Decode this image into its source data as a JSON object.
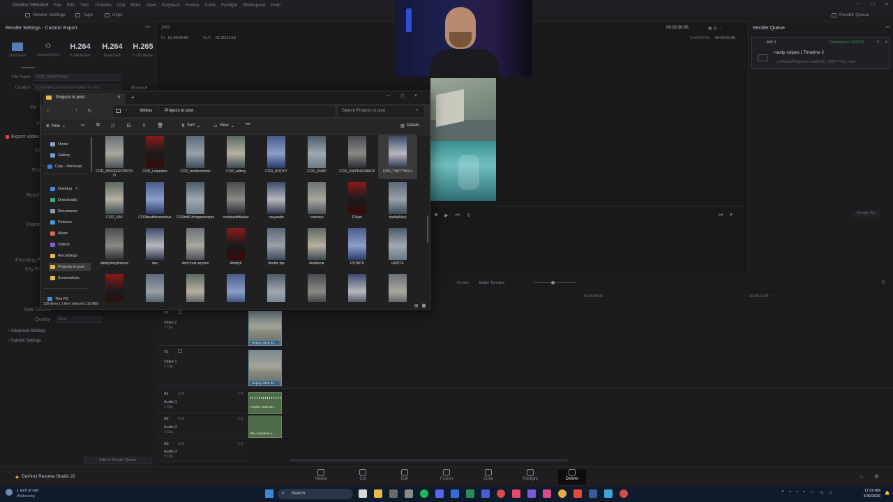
{
  "menubar": {
    "app_name": "DaVinci Resolve",
    "items": [
      "File",
      "Edit",
      "Trim",
      "Timeline",
      "Clip",
      "Mark",
      "View",
      "Playback",
      "Fusion",
      "Color",
      "Fairlight",
      "Workspace",
      "Help"
    ]
  },
  "toolbar": {
    "render_settings": "Render Settings",
    "tape": "Tape",
    "clips": "Clips",
    "render_queue": "Render Queue"
  },
  "render_panel": {
    "title": "Render Settings - Custom Export",
    "presets": [
      {
        "big": "",
        "small": "Short Form"
      },
      {
        "big": "",
        "small": "Custom Export"
      },
      {
        "big": "H.264",
        "small": "H.264 Master"
      },
      {
        "big": "H.264",
        "small": "HyperDeck"
      },
      {
        "big": "H.265",
        "small": "H.265 Master"
      }
    ],
    "file_name_label": "File Name",
    "file_name_value": "COD_TWITTYKILL",
    "location_label": "Location",
    "location_value": "C:\\Users\\cory\\Videos\\Projects to post",
    "browse": "Browse",
    "export_video": "Export Video",
    "encoding_label": "Encoding Pr",
    "key_frames": "Key Fr",
    "rate_control": "Rate Control",
    "quality_label": "Quality",
    "quality_value": "Best",
    "advanced": "Advanced Settings",
    "subtitle": "Subtitle Settings",
    "add_to_queue": "Add to Render Queue",
    "side_labels": [
      "Re",
      "V",
      "Fo",
      "Enc",
      "Resol",
      "Frame"
    ]
  },
  "viewer": {
    "zoom": "24%",
    "in_label": "IN",
    "in_tc": "01:00:00:00",
    "out_label": "OUT",
    "out_tc": "01:00:21:54",
    "timecode": "00:03:36:06",
    "duration_label": "DURATION",
    "duration_tc": "00:00:21:55"
  },
  "queue": {
    "title": "Render Queue",
    "job": "Job 1",
    "job_status": "Completed in 00:00:25",
    "job_name": "nasty snipes | Timeline 2",
    "job_path": "...ry\\Videos\\Projects to post\\COD_TWITTYKILL.mp4",
    "render_all": "Render All"
  },
  "timeline": {
    "render_label": "Render",
    "render_value": "Entire Timeline",
    "ruler": [
      "01:00:08:00",
      "01:00:12:00"
    ],
    "tracks": [
      {
        "id": "V2",
        "name": "Video 2",
        "clips": "1 Clip",
        "clip_label": "Replay 2026-03-..."
      },
      {
        "id": "V1",
        "name": "Video 1",
        "clips": "1 Clip",
        "clip_label": "Replay 2026-03-..."
      },
      {
        "id": "A1",
        "name": "Audio 1",
        "clips": "1 Clip",
        "level": "2.0",
        "clip_label": "Replay 2026-03-..."
      },
      {
        "id": "A2",
        "name": "Audio 2",
        "clips": "1 Clip",
        "level": "2.0",
        "clip_label": "the_mountain-e..."
      },
      {
        "id": "A3",
        "name": "Audio 3",
        "clips": "0 Clip",
        "level": "2.0",
        "clip_label": ""
      }
    ]
  },
  "explorer": {
    "tab_title": "Projects to post",
    "breadcrumb": [
      "Videos",
      "Projects to post"
    ],
    "search_placeholder": "Search Projects to post",
    "new": "New",
    "sort": "Sort",
    "view": "View",
    "details": "Details",
    "sidebar": [
      "Home",
      "Gallery",
      "Cory - Personal",
      "Desktop",
      "Downloads",
      "Documents",
      "Pictures",
      "Music",
      "Videos",
      "Recordings",
      "Projects to post",
      "Screenshots",
      "This PC"
    ],
    "files": [
      "COD_HOUSEROTATION",
      "COD_Leeplates",
      "COD_modsrebetter",
      "COD_rafting",
      "COD_ROCKY",
      "COD_SNAP",
      "COD_SNIPINGSBACK",
      "COD_TWITTYKILL",
      "COD_UAV",
      "CODdeathframebove",
      "CODtoBFchoppersnipes",
      "cookinwiththekar",
      "coryaudio",
      "crashout",
      "D3vyn",
      "daddyikkey",
      "daddylikeythatone",
      "dev",
      "dont trust anyone",
      "dontryit",
      "double tap",
      "doublecar",
      "DSTACK",
      "EMOTE",
      "",
      "",
      "",
      "",
      "",
      "",
      "",
      ""
    ],
    "status": "139 items  |  1 item selected 118 MB  |"
  },
  "pages": [
    "Media",
    "Cut",
    "Edit",
    "Fusion",
    "Color",
    "Fairlight",
    "Deliver"
  ],
  "footer": {
    "product": "DaVinci Resolve Studio 20"
  },
  "taskbar": {
    "weather": "1 inch of rain",
    "weather_sub": "Wednesday",
    "search": "Search",
    "time": "11:09 AM",
    "date": "3/30/2026"
  }
}
